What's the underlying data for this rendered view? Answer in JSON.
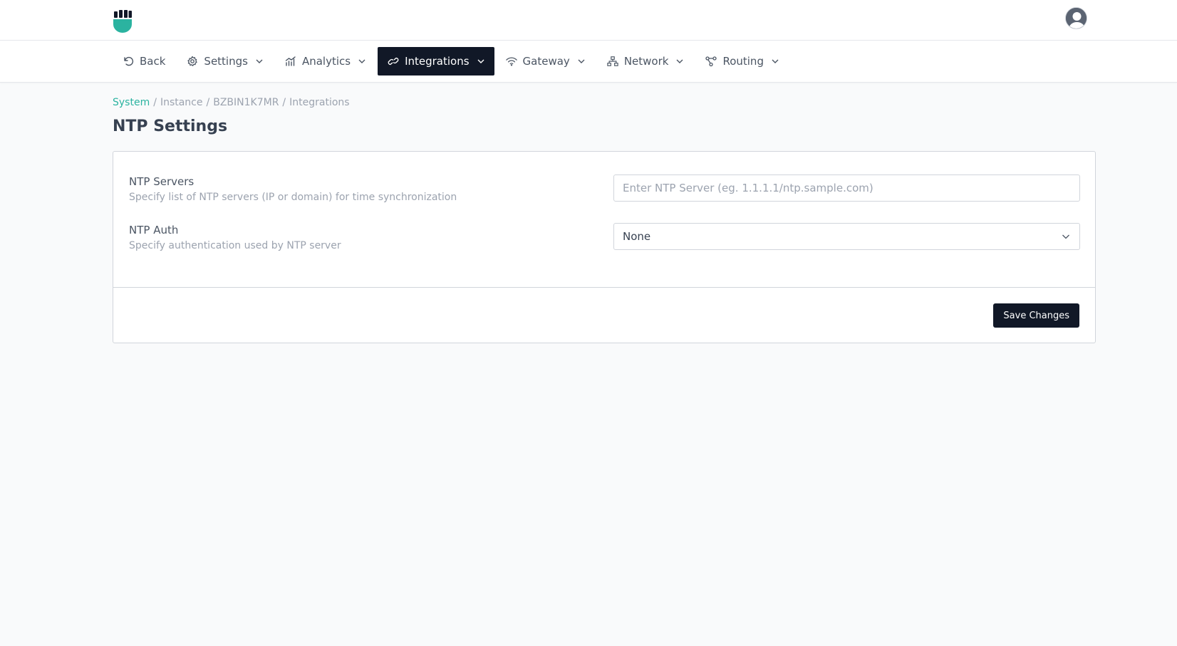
{
  "header": {
    "logo_icon": "fist-shield-logo",
    "avatar_icon": "user-avatar-icon"
  },
  "nav": {
    "items": [
      {
        "label": "Back",
        "icon": "undo-icon",
        "dropdown": false,
        "active": false
      },
      {
        "label": "Settings",
        "icon": "gear-icon",
        "dropdown": true,
        "active": false
      },
      {
        "label": "Analytics",
        "icon": "bar-chart-icon",
        "dropdown": true,
        "active": false
      },
      {
        "label": "Integrations",
        "icon": "link-icon",
        "dropdown": true,
        "active": true
      },
      {
        "label": "Gateway",
        "icon": "wifi-icon",
        "dropdown": true,
        "active": false
      },
      {
        "label": "Network",
        "icon": "network-icon",
        "dropdown": true,
        "active": false
      },
      {
        "label": "Routing",
        "icon": "routing-icon",
        "dropdown": true,
        "active": false
      }
    ]
  },
  "breadcrumb": {
    "items": [
      "System",
      "Instance",
      "BZBIN1K7MR",
      "Integrations"
    ],
    "separator": "/"
  },
  "page": {
    "title": "NTP Settings"
  },
  "form": {
    "ntp_servers": {
      "label": "NTP Servers",
      "description": "Specify list of NTP servers (IP or domain) for time synchronization",
      "value": "",
      "placeholder": "Enter NTP Server (eg. 1.1.1.1/ntp.sample.com)"
    },
    "ntp_auth": {
      "label": "NTP Auth",
      "description": "Specify authentication used by NTP server",
      "selected": "None"
    },
    "save_label": "Save Changes"
  },
  "colors": {
    "accent": "#2bb3a0",
    "dark": "#111827",
    "background": "#f9fafb"
  }
}
